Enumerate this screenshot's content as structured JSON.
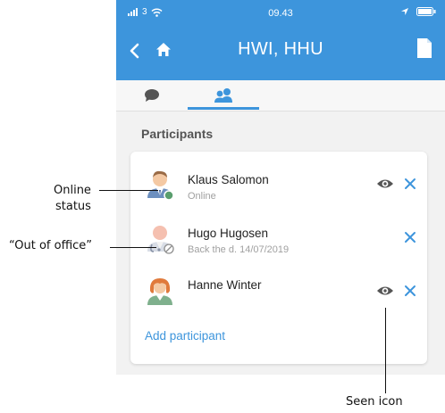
{
  "status_bar": {
    "signal": "3",
    "time": "09.43"
  },
  "header": {
    "title": "HWI, HHU"
  },
  "tabs": [
    {
      "name": "chat",
      "active": false
    },
    {
      "name": "participants",
      "active": true
    }
  ],
  "participants_section": {
    "title": "Participants",
    "items": [
      {
        "name": "Klaus Salomon",
        "status": "Online",
        "presence": "online",
        "seen": true,
        "removable": true
      },
      {
        "name": "Hugo Hugosen",
        "status": "Back the d. 14/07/2019",
        "presence": "out-of-office",
        "seen": false,
        "removable": true
      },
      {
        "name": "Hanne Winter",
        "status": "",
        "presence": "none",
        "seen": true,
        "removable": true
      }
    ],
    "add_label": "Add participant"
  },
  "callouts": {
    "online_status": [
      "Online",
      "status"
    ],
    "out_of_office": "“Out of office”",
    "seen_icon": "Seen icon"
  },
  "colors": {
    "accent": "#3d95dc",
    "online": "#5a9e6e",
    "icon_gray": "#555555"
  }
}
